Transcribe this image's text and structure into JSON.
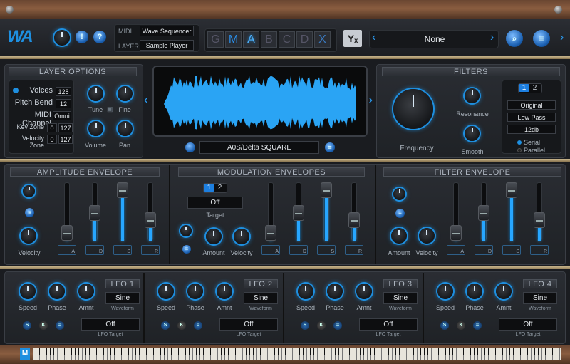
{
  "top": {
    "midi_label": "MIDI",
    "midi_value": "Wave Sequencer",
    "layer_label": "LAYER",
    "layer_value": "Sample Player",
    "letters": [
      "G",
      "M",
      "A",
      "B",
      "C",
      "D",
      "X"
    ],
    "yx_label": "Yₓ",
    "preset": "None",
    "help_label": "!",
    "q_label": "?"
  },
  "layer_options": {
    "title": "LAYER OPTIONS",
    "voices_label": "Voices",
    "voices_value": "128",
    "pitch_label": "Pitch Bend",
    "pitch_value": "12",
    "midi_channel_label": "MIDI Channel",
    "midi_channel_value": "Omni",
    "keyzone_label": "Key Zone",
    "keyzone_low": "0",
    "keyzone_high": "127",
    "velzone_label": "Velocity Zone",
    "velzone_low": "0",
    "velzone_high": "127",
    "tune": "Tune",
    "fine": "Fine",
    "volume": "Volume",
    "pan": "Pan"
  },
  "waveform": {
    "sample_name": "A0S/Delta SQUARE"
  },
  "filters": {
    "title": "FILTERS",
    "tab1": "1",
    "tab2": "2",
    "frequency": "Frequency",
    "resonance": "Resonance",
    "smooth": "Smooth",
    "mode": "Original",
    "type": "Low Pass",
    "slope": "12db",
    "serial": "Serial",
    "parallel": "Parallel"
  },
  "amp_env": {
    "title": "AMPLITUDE ENVELOPE",
    "velocity": "Velocity",
    "adsr": [
      "A",
      "D",
      "S",
      "R"
    ]
  },
  "mod_env": {
    "title": "MODULATION ENVELOPES",
    "tab1": "1",
    "tab2": "2",
    "target_value": "Off",
    "target_label": "Target",
    "amount": "Amount",
    "velocity": "Velocity",
    "adsr": [
      "A",
      "D",
      "S",
      "R"
    ]
  },
  "filt_env": {
    "title": "FILTER ENVELOPE",
    "amount": "Amount",
    "velocity": "Velocity",
    "adsr": [
      "A",
      "D",
      "S",
      "R"
    ]
  },
  "lfos": [
    {
      "title": "LFO 1",
      "waveform": "Sine",
      "waveform_label": "Waveform",
      "target": "Off",
      "target_label": "LFO Target",
      "speed": "Speed",
      "phase": "Phase",
      "amnt": "Amnt",
      "s": "S",
      "k": "K"
    },
    {
      "title": "LFO 2",
      "waveform": "Sine",
      "waveform_label": "Waveform",
      "target": "Off",
      "target_label": "LFO Target",
      "speed": "Speed",
      "phase": "Phase",
      "amnt": "Amnt",
      "s": "S",
      "k": "K"
    },
    {
      "title": "LFO 3",
      "waveform": "Sine",
      "waveform_label": "Waveform",
      "target": "Off",
      "target_label": "LFO Target",
      "speed": "Speed",
      "phase": "Phase",
      "amnt": "Amnt",
      "s": "S",
      "k": "K"
    },
    {
      "title": "LFO 4",
      "waveform": "Sine",
      "waveform_label": "Waveform",
      "target": "Off",
      "target_label": "LFO Target",
      "speed": "Speed",
      "phase": "Phase",
      "amnt": "Amnt",
      "s": "S",
      "k": "K"
    }
  ],
  "keyboard": {
    "m_label": "M"
  },
  "colors": {
    "accent": "#1e8fe0",
    "wave": "#2aa4f4"
  }
}
